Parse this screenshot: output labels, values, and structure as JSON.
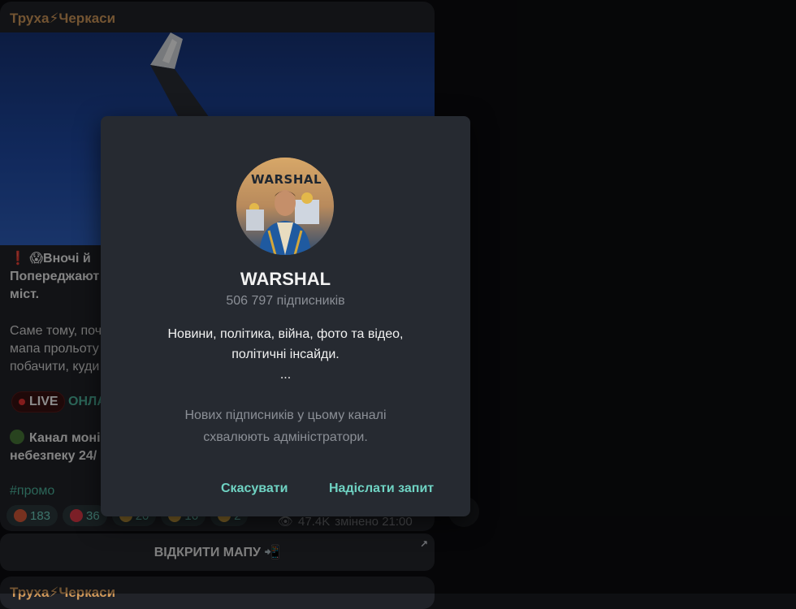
{
  "post": {
    "channel": "Труха⚡Черкаси",
    "text_line1": "❗ 😱Вночі й",
    "text_line2": "Попереджают",
    "text_line3": "міст.",
    "para2_line1": "Саме тому, поч",
    "para2_line2": "мапа прольоту",
    "para2_line3": "побачити, куди",
    "live_label": "LIVE",
    "online_text": "ОНЛА",
    "monitor_line1": "Канал моні",
    "monitor_line2": "небезпеку 24/",
    "promo_tag": "#промо",
    "reactions": [
      {
        "count": "183",
        "color": "#d85a3a"
      },
      {
        "count": "36",
        "color": "#e23b4a"
      },
      {
        "count": "20",
        "color": "#e8b54a"
      },
      {
        "count": "16",
        "color": "#e8b54a"
      },
      {
        "count": "2",
        "color": "#e8b54a"
      }
    ],
    "views": "47.4K",
    "edited": "змінено 21:00",
    "open_map_label": "ВІДКРИТИ МАПУ 📲",
    "next_channel": "Труха⚡Черкаси"
  },
  "modal": {
    "avatar_text": "WARSHAL",
    "channel_name": "WARSHAL",
    "subscribers": "506 797 підписників",
    "description": "Новини, політика, війна, фото та відео,\nполітичні інсайди.\n...",
    "approval_note": "Нових підписників у цьому каналі\nсхвалюють адміністратори.",
    "cancel_label": "Скасувати",
    "send_label": "Надіслати запит"
  }
}
